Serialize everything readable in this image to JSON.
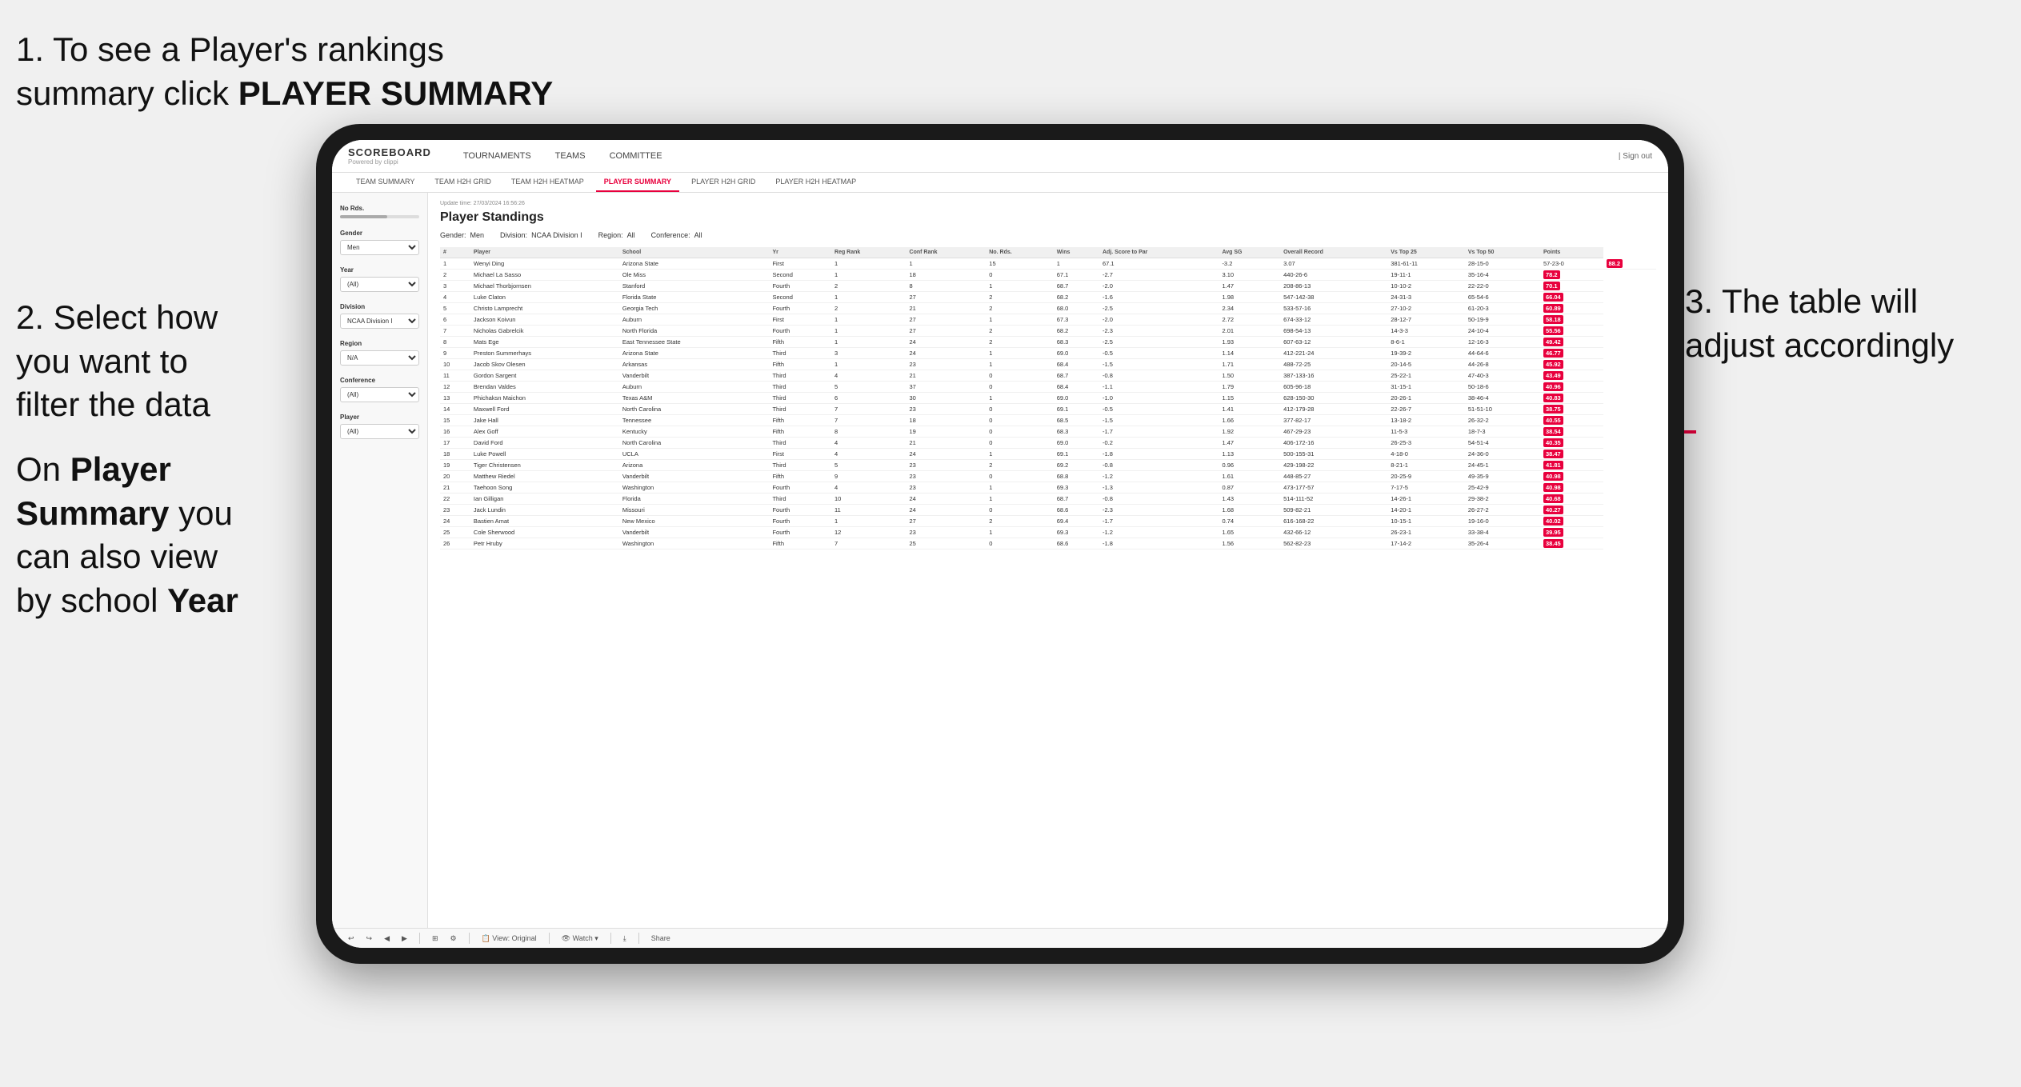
{
  "annotations": {
    "annotation1_line1": "1. To see a Player's rankings",
    "annotation1_line2": "summary click ",
    "annotation1_bold": "PLAYER SUMMARY",
    "annotation2_line1": "2. Select how",
    "annotation2_line2": "you want to",
    "annotation2_line3": "filter the data",
    "annotation_bottom_line1": "On ",
    "annotation_bottom_bold1": "Player",
    "annotation_bottom_line2": "Summary",
    "annotation_bottom_bold2": " you",
    "annotation_bottom_line3": "can also view",
    "annotation_bottom_line4": "by school ",
    "annotation_bottom_bold3": "Year",
    "annotation3_line1": "3. The table will",
    "annotation3_line2": "adjust accordingly"
  },
  "app": {
    "logo": "SCOREBOARD",
    "logo_sub": "Powered by clippi",
    "nav_items": [
      "TOURNAMENTS",
      "TEAMS",
      "COMMITTEE"
    ],
    "nav_right_1": "| Sign out",
    "sub_nav_items": [
      "TEAM SUMMARY",
      "TEAM H2H GRID",
      "TEAM H2H HEATMAP",
      "PLAYER SUMMARY",
      "PLAYER H2H GRID",
      "PLAYER H2H HEATMAP"
    ],
    "active_sub_nav": "PLAYER SUMMARY"
  },
  "sidebar": {
    "no_rds_label": "No Rds.",
    "gender_label": "Gender",
    "gender_value": "Men",
    "year_label": "Year",
    "year_value": "(All)",
    "division_label": "Division",
    "division_value": "NCAA Division I",
    "region_label": "Region",
    "region_value": "N/A",
    "conference_label": "Conference",
    "conference_value": "(All)",
    "player_label": "Player",
    "player_value": "(All)"
  },
  "content": {
    "update_time": "Update time: 27/03/2024 16:56:26",
    "title": "Player Standings",
    "gender_label": "Gender:",
    "gender_value": "Men",
    "division_label": "Division:",
    "division_value": "NCAA Division I",
    "region_label": "Region:",
    "region_value": "All",
    "conference_label": "Conference:",
    "conference_value": "All"
  },
  "table": {
    "headers": [
      "#",
      "Player",
      "School",
      "Yr",
      "Reg Rank",
      "Conf Rank",
      "No. Rds.",
      "Wins",
      "Adj. Score to Par",
      "Avg SG",
      "Overall Record",
      "Vs Top 25",
      "Vs Top 50",
      "Points"
    ],
    "rows": [
      [
        "1",
        "Wenyi Ding",
        "Arizona State",
        "First",
        "1",
        "1",
        "15",
        "1",
        "67.1",
        "-3.2",
        "3.07",
        "381-61-11",
        "28-15-0",
        "57-23-0",
        "88.2"
      ],
      [
        "2",
        "Michael La Sasso",
        "Ole Miss",
        "Second",
        "1",
        "18",
        "0",
        "67.1",
        "-2.7",
        "3.10",
        "440-26-6",
        "19-11-1",
        "35-16-4",
        "78.2"
      ],
      [
        "3",
        "Michael Thorbjornsen",
        "Stanford",
        "Fourth",
        "2",
        "8",
        "1",
        "68.7",
        "-2.0",
        "1.47",
        "208-86-13",
        "10-10-2",
        "22-22-0",
        "70.1"
      ],
      [
        "4",
        "Luke Claton",
        "Florida State",
        "Second",
        "1",
        "27",
        "2",
        "68.2",
        "-1.6",
        "1.98",
        "547-142-38",
        "24-31-3",
        "65-54-6",
        "66.04"
      ],
      [
        "5",
        "Christo Lamprecht",
        "Georgia Tech",
        "Fourth",
        "2",
        "21",
        "2",
        "68.0",
        "-2.5",
        "2.34",
        "533-57-16",
        "27-10-2",
        "61-20-3",
        "60.89"
      ],
      [
        "6",
        "Jackson Koivun",
        "Auburn",
        "First",
        "1",
        "27",
        "1",
        "67.3",
        "-2.0",
        "2.72",
        "674-33-12",
        "28-12-7",
        "50-19-9",
        "58.18"
      ],
      [
        "7",
        "Nicholas Gabrelcik",
        "North Florida",
        "Fourth",
        "1",
        "27",
        "2",
        "68.2",
        "-2.3",
        "2.01",
        "698-54-13",
        "14-3-3",
        "24-10-4",
        "55.56"
      ],
      [
        "8",
        "Mats Ege",
        "East Tennessee State",
        "Fifth",
        "1",
        "24",
        "2",
        "68.3",
        "-2.5",
        "1.93",
        "607-63-12",
        "8-6-1",
        "12-16-3",
        "49.42"
      ],
      [
        "9",
        "Preston Summerhays",
        "Arizona State",
        "Third",
        "3",
        "24",
        "1",
        "69.0",
        "-0.5",
        "1.14",
        "412-221-24",
        "19-39-2",
        "44-64-6",
        "46.77"
      ],
      [
        "10",
        "Jacob Skov Olesen",
        "Arkansas",
        "Fifth",
        "1",
        "23",
        "1",
        "68.4",
        "-1.5",
        "1.71",
        "488-72-25",
        "20-14-5",
        "44-26-8",
        "45.92"
      ],
      [
        "11",
        "Gordon Sargent",
        "Vanderbilt",
        "Third",
        "4",
        "21",
        "0",
        "68.7",
        "-0.8",
        "1.50",
        "387-133-16",
        "25-22-1",
        "47-40-3",
        "43.49"
      ],
      [
        "12",
        "Brendan Valdes",
        "Auburn",
        "Third",
        "5",
        "37",
        "0",
        "68.4",
        "-1.1",
        "1.79",
        "605-96-18",
        "31-15-1",
        "50-18-6",
        "40.96"
      ],
      [
        "13",
        "Phichaksn Maichon",
        "Texas A&M",
        "Third",
        "6",
        "30",
        "1",
        "69.0",
        "-1.0",
        "1.15",
        "628-150-30",
        "20-26-1",
        "38-46-4",
        "40.83"
      ],
      [
        "14",
        "Maxwell Ford",
        "North Carolina",
        "Third",
        "7",
        "23",
        "0",
        "69.1",
        "-0.5",
        "1.41",
        "412-179-28",
        "22-26-7",
        "51-51-10",
        "38.75"
      ],
      [
        "15",
        "Jake Hall",
        "Tennessee",
        "Fifth",
        "7",
        "18",
        "0",
        "68.5",
        "-1.5",
        "1.66",
        "377-82-17",
        "13-18-2",
        "26-32-2",
        "40.55"
      ],
      [
        "16",
        "Alex Goff",
        "Kentucky",
        "Fifth",
        "8",
        "19",
        "0",
        "68.3",
        "-1.7",
        "1.92",
        "467-29-23",
        "11-5-3",
        "18-7-3",
        "38.54"
      ],
      [
        "17",
        "David Ford",
        "North Carolina",
        "Third",
        "4",
        "21",
        "0",
        "69.0",
        "-0.2",
        "1.47",
        "406-172-16",
        "26-25-3",
        "54-51-4",
        "40.35"
      ],
      [
        "18",
        "Luke Powell",
        "UCLA",
        "First",
        "4",
        "24",
        "1",
        "69.1",
        "-1.8",
        "1.13",
        "500-155-31",
        "4-18-0",
        "24-36-0",
        "38.47"
      ],
      [
        "19",
        "Tiger Christensen",
        "Arizona",
        "Third",
        "5",
        "23",
        "2",
        "69.2",
        "-0.8",
        "0.96",
        "429-198-22",
        "8-21-1",
        "24-45-1",
        "41.81"
      ],
      [
        "20",
        "Matthew Riedel",
        "Vanderbilt",
        "Fifth",
        "9",
        "23",
        "0",
        "68.8",
        "-1.2",
        "1.61",
        "448-85-27",
        "20-25-9",
        "49-35-9",
        "40.98"
      ],
      [
        "21",
        "Taehoon Song",
        "Washington",
        "Fourth",
        "4",
        "23",
        "1",
        "69.3",
        "-1.3",
        "0.87",
        "473-177-57",
        "7-17-5",
        "25-42-9",
        "40.98"
      ],
      [
        "22",
        "Ian Gilligan",
        "Florida",
        "Third",
        "10",
        "24",
        "1",
        "68.7",
        "-0.8",
        "1.43",
        "514-111-52",
        "14-26-1",
        "29-38-2",
        "40.68"
      ],
      [
        "23",
        "Jack Lundin",
        "Missouri",
        "Fourth",
        "11",
        "24",
        "0",
        "68.6",
        "-2.3",
        "1.68",
        "509-82-21",
        "14-20-1",
        "26-27-2",
        "40.27"
      ],
      [
        "24",
        "Bastien Amat",
        "New Mexico",
        "Fourth",
        "1",
        "27",
        "2",
        "69.4",
        "-1.7",
        "0.74",
        "616-168-22",
        "10-15-1",
        "19-16-0",
        "40.02"
      ],
      [
        "25",
        "Cole Sherwood",
        "Vanderbilt",
        "Fourth",
        "12",
        "23",
        "1",
        "69.3",
        "-1.2",
        "1.65",
        "432-66-12",
        "26-23-1",
        "33-38-4",
        "39.95"
      ],
      [
        "26",
        "Petr Hruby",
        "Washington",
        "Fifth",
        "7",
        "25",
        "0",
        "68.6",
        "-1.8",
        "1.56",
        "562-82-23",
        "17-14-2",
        "35-26-4",
        "38.45"
      ]
    ]
  },
  "toolbar": {
    "undo": "↩",
    "redo": "↪",
    "back": "◀",
    "forward": "▶",
    "print": "⊟",
    "view_label": "View: Original",
    "watch_label": "👁 Watch ▾",
    "export_label": "⤓",
    "share_label": "Share"
  }
}
